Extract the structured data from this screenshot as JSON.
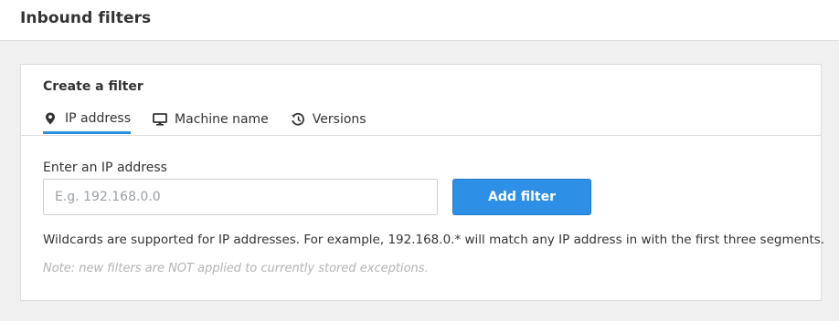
{
  "header": {
    "title": "Inbound filters"
  },
  "card": {
    "title": "Create a filter",
    "tabs": [
      {
        "label": "IP address",
        "icon": "map-pin-icon",
        "active": true
      },
      {
        "label": "Machine name",
        "icon": "monitor-icon",
        "active": false
      },
      {
        "label": "Versions",
        "icon": "history-icon",
        "active": false
      }
    ],
    "field_label": "Enter an IP address",
    "input": {
      "value": "",
      "placeholder": "E.g. 192.168.0.0"
    },
    "add_button_label": "Add filter",
    "help_text": "Wildcards are supported for IP addresses. For example, 192.168.0.* will match any IP address in with the first three segments.",
    "note_text": "Note: new filters are NOT applied to currently stored exceptions."
  },
  "colors": {
    "accent": "#2d8fe6",
    "tab_underline": "#2d8fdf",
    "note": "#b4b4b4",
    "background": "#f0f0f0"
  }
}
